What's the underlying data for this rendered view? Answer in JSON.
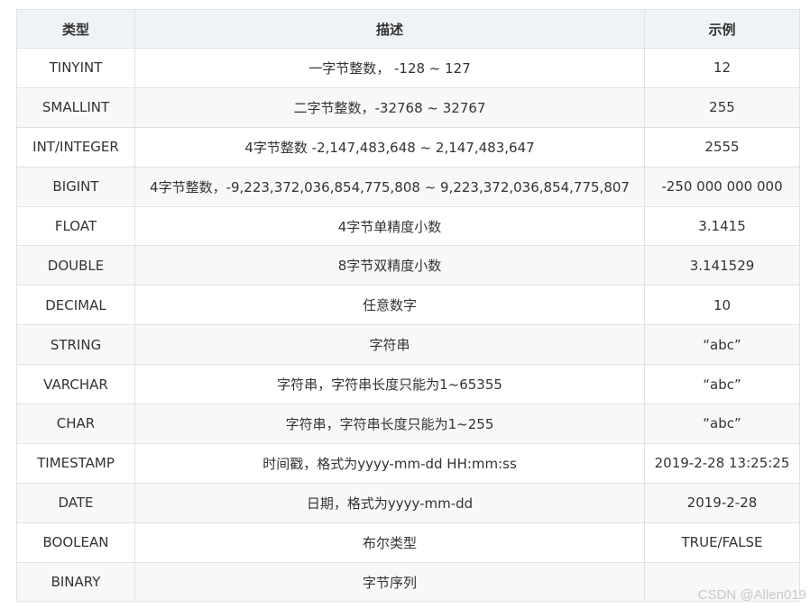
{
  "table": {
    "headers": [
      "类型",
      "描述",
      "示例"
    ],
    "rows": [
      {
        "type": "TINYINT",
        "desc": "一字节整数， -128 ~ 127",
        "example": "12"
      },
      {
        "type": "SMALLINT",
        "desc": "二字节整数，-32768 ~ 32767",
        "example": "255"
      },
      {
        "type": "INT/INTEGER",
        "desc": "4字节整数 -2,147,483,648 ~ 2,147,483,647",
        "example": "2555"
      },
      {
        "type": "BIGINT",
        "desc": "4字节整数，-9,223,372,036,854,775,808 ~ 9,223,372,036,854,775,807",
        "example": "-250 000 000 000"
      },
      {
        "type": "FLOAT",
        "desc": "4字节单精度小数",
        "example": "3.1415"
      },
      {
        "type": "DOUBLE",
        "desc": "8字节双精度小数",
        "example": "3.141529"
      },
      {
        "type": "DECIMAL",
        "desc": "任意数字",
        "example": "10"
      },
      {
        "type": "STRING",
        "desc": "字符串",
        "example": "“abc”"
      },
      {
        "type": "VARCHAR",
        "desc": "字符串，字符串长度只能为1~65355",
        "example": "“abc”"
      },
      {
        "type": "CHAR",
        "desc": "字符串，字符串长度只能为1~255",
        "example": "“abc”"
      },
      {
        "type": "TIMESTAMP",
        "desc": "时间戳，格式为yyyy-mm-dd HH:mm:ss",
        "example": "2019-2-28 13:25:25"
      },
      {
        "type": "DATE",
        "desc": "日期，格式为yyyy-mm-dd",
        "example": "2019-2-28"
      },
      {
        "type": "BOOLEAN",
        "desc": "布尔类型",
        "example": "TRUE/FALSE"
      },
      {
        "type": "BINARY",
        "desc": "字节序列",
        "example": ""
      }
    ]
  },
  "watermark": "CSDN @Allen019",
  "colors": {
    "header_bg": "#eff3f5",
    "stripe_bg": "#f8f8f8",
    "border": "#dfe2e5",
    "text": "#333333"
  }
}
